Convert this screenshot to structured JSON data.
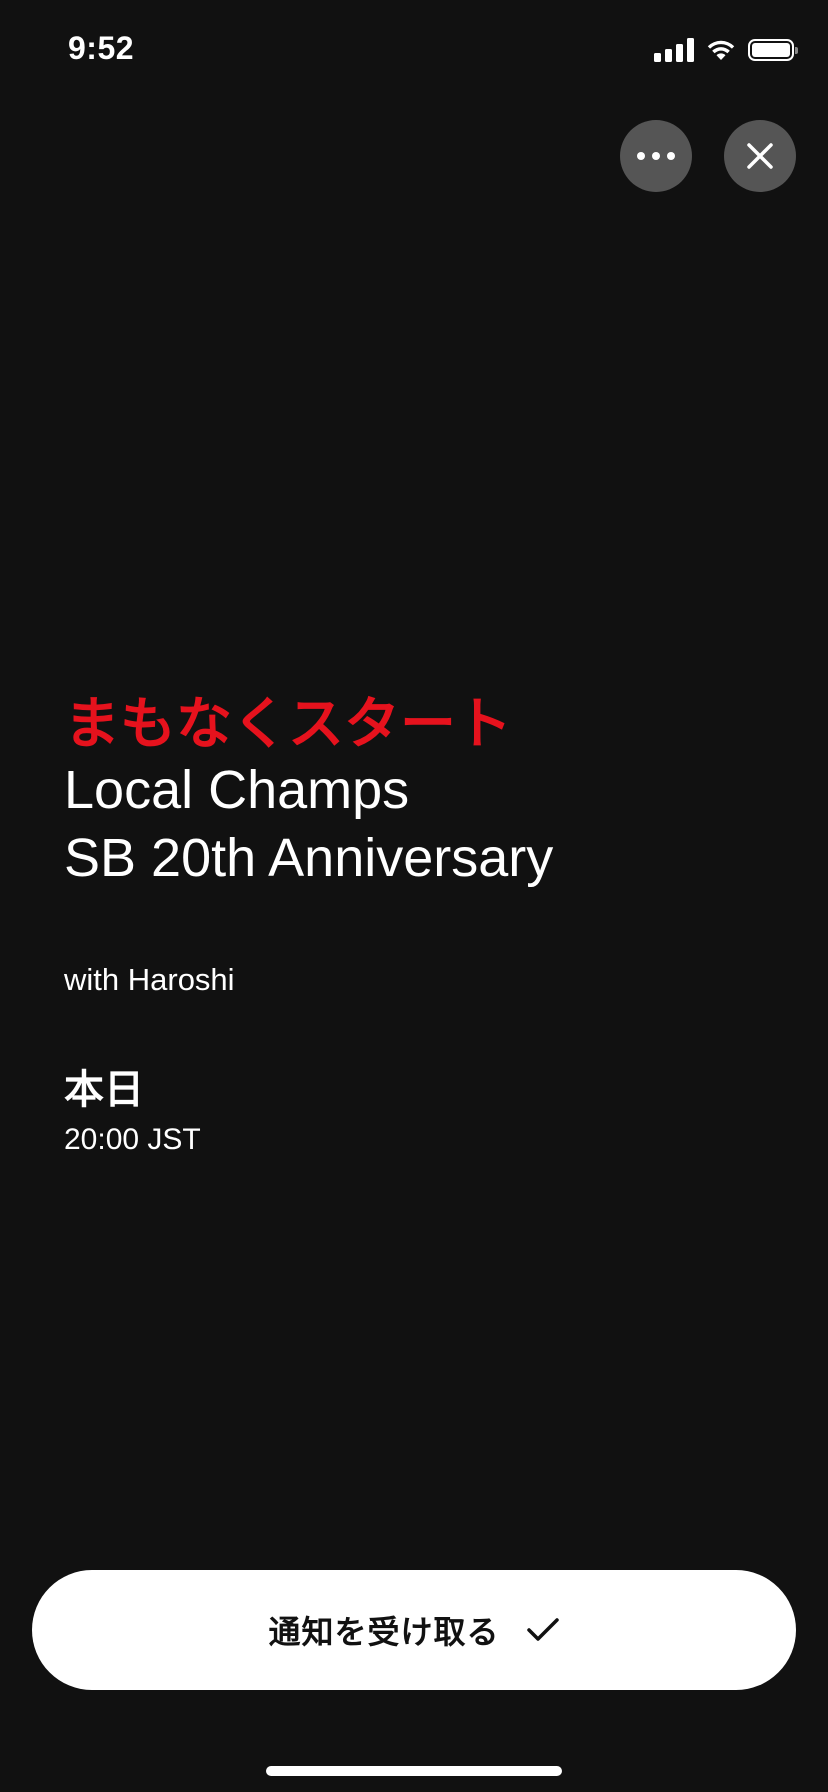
{
  "status_bar": {
    "time": "9:52",
    "icons": [
      "cellular-signal-icon",
      "wifi-icon",
      "battery-icon"
    ]
  },
  "top_buttons": {
    "more_icon": "more-horizontal-icon",
    "close_icon": "close-icon"
  },
  "event": {
    "headline": "まもなくスタート",
    "title_lines": [
      "Local Champs",
      "SB 20th Anniversary"
    ],
    "subtitle": "with Haroshi",
    "date": "本日",
    "time": "20:00 JST"
  },
  "notify_button": {
    "label": "通知を受け取る",
    "icon": "checkmark-icon"
  },
  "colors": {
    "background": "#111111",
    "accent": "#e6121d",
    "button_bg": "#ffffff",
    "circle_button_bg": "#555555"
  }
}
